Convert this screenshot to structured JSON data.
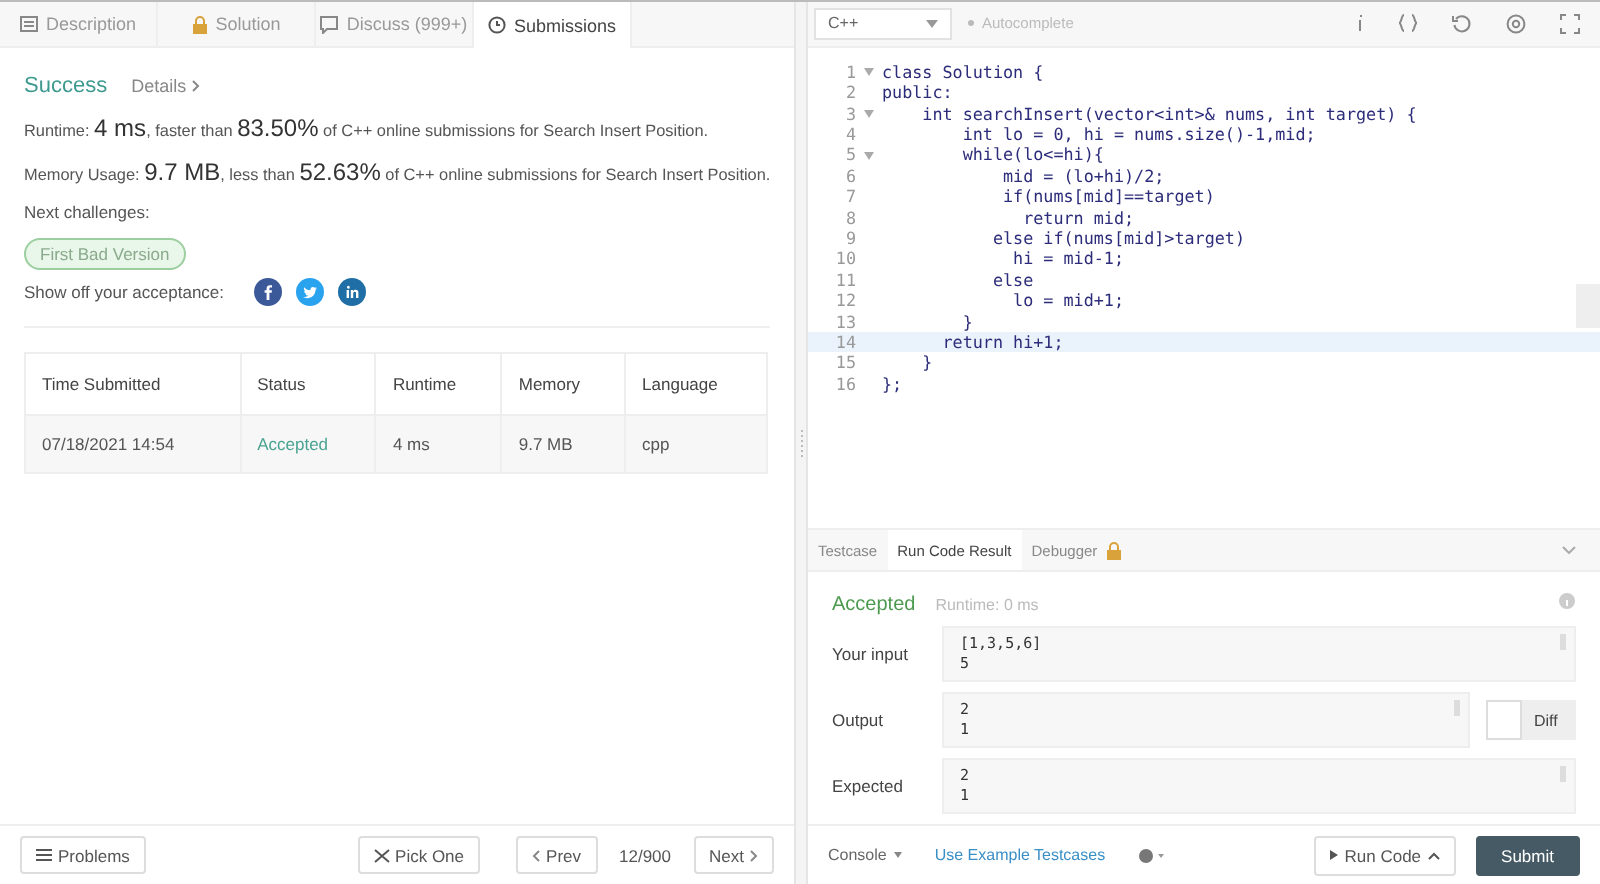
{
  "left_tabs": [
    {
      "label": "Description",
      "selected": false
    },
    {
      "label": "Solution",
      "selected": false
    },
    {
      "label": "Discuss (999+)",
      "selected": false
    },
    {
      "label": "Submissions",
      "selected": true
    }
  ],
  "result": {
    "status": "Success",
    "details": "Details",
    "runtime": {
      "label": "Runtime:",
      "value": "4 ms",
      "middle": ", faster than",
      "percent": "83.50%",
      "tail": "of C++ online submissions for Search Insert Position."
    },
    "memory": {
      "label": "Memory Usage:",
      "value": "9.7 MB",
      "middle": ", less than",
      "percent": "52.63%",
      "tail": "of C++ online submissions for Search Insert Position."
    },
    "next_label": "Next challenges:",
    "next_challenges": [
      "First Bad Version"
    ],
    "share_label": "Show off your acceptance:"
  },
  "table": {
    "columns": [
      "Time Submitted",
      "Status",
      "Runtime",
      "Memory",
      "Language"
    ],
    "rows": [
      [
        "07/18/2021 14:54",
        "Accepted",
        "4 ms",
        "9.7 MB",
        "cpp"
      ]
    ]
  },
  "left_footer": {
    "problems": "Problems",
    "pick_one": "Pick One",
    "prev": "Prev",
    "page": "12/900",
    "next": "Next"
  },
  "editor": {
    "language": "C++",
    "autocomplete": {
      "label": "Autocomplete",
      "on": false
    },
    "lines": [
      {
        "num": "1",
        "text": "class Solution {",
        "foldable": true,
        "active": false
      },
      {
        "num": "2",
        "text": "public:",
        "foldable": false,
        "active": false
      },
      {
        "num": "3",
        "text": "    int searchInsert(vector<int>& nums, int target) {",
        "foldable": true,
        "active": false
      },
      {
        "num": "4",
        "text": "        int lo = 0, hi = nums.size()-1,mid;",
        "foldable": false,
        "active": false
      },
      {
        "num": "5",
        "text": "        while(lo<=hi){",
        "foldable": true,
        "active": false
      },
      {
        "num": "6",
        "text": "            mid = (lo+hi)/2;",
        "foldable": false,
        "active": false
      },
      {
        "num": "7",
        "text": "            if(nums[mid]==target)",
        "foldable": false,
        "active": false
      },
      {
        "num": "8",
        "text": "              return mid;",
        "foldable": false,
        "active": false
      },
      {
        "num": "9",
        "text": "           else if(nums[mid]>target)",
        "foldable": false,
        "active": false
      },
      {
        "num": "10",
        "text": "             hi = mid-1;",
        "foldable": false,
        "active": false
      },
      {
        "num": "11",
        "text": "           else",
        "foldable": false,
        "active": false
      },
      {
        "num": "12",
        "text": "             lo = mid+1;",
        "foldable": false,
        "active": false
      },
      {
        "num": "13",
        "text": "        }",
        "foldable": false,
        "active": false
      },
      {
        "num": "14",
        "text": "      return hi+1;",
        "foldable": false,
        "active": true
      },
      {
        "num": "15",
        "text": "    }",
        "foldable": false,
        "active": false
      },
      {
        "num": "16",
        "text": "};",
        "foldable": false,
        "active": false
      }
    ]
  },
  "console_tabs": [
    {
      "label": "Testcase",
      "selected": false,
      "locked": false
    },
    {
      "label": "Run Code Result",
      "selected": true,
      "locked": false
    },
    {
      "label": "Debugger",
      "selected": false,
      "locked": true
    }
  ],
  "run_result": {
    "status": "Accepted",
    "runtime": "Runtime: 0 ms",
    "rows": [
      {
        "label": "Your input",
        "lines": [
          "[1,3,5,6]",
          "5"
        ]
      },
      {
        "label": "Output",
        "lines": [
          "2",
          "1"
        ]
      },
      {
        "label": "Expected",
        "lines": [
          "2",
          "1"
        ]
      }
    ],
    "diff": {
      "label": "Diff",
      "on": false
    }
  },
  "right_footer": {
    "console": "Console",
    "example": "Use Example Testcases",
    "run": "Run Code",
    "submit": "Submit"
  }
}
